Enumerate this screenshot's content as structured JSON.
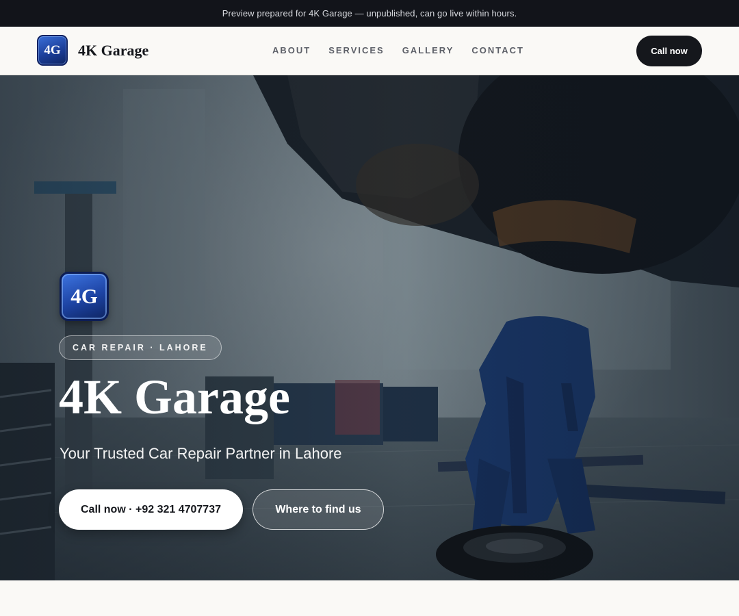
{
  "banner": {
    "text": "Preview prepared for 4K Garage — unpublished, can go live within hours."
  },
  "header": {
    "logo_text": "4G",
    "brand_name": "4K Garage",
    "menu": [
      {
        "label": "ABOUT"
      },
      {
        "label": "SERVICES"
      },
      {
        "label": "GALLERY"
      },
      {
        "label": "CONTACT"
      }
    ],
    "cta_label": "Call now"
  },
  "hero": {
    "logo_text": "4G",
    "eyebrow": "CAR REPAIR · LAHORE",
    "title": "4K Garage",
    "subtitle": "Your Trusted Car Repair Partner in Lahore",
    "primary_button": "Call now · +92 321 4707737",
    "secondary_button": "Where to find us",
    "background_image": "mechanic-under-lifted-car-workshop-photo"
  },
  "colors": {
    "banner_bg": "#12141a",
    "nav_bg": "#faf9f6",
    "cta_bg": "#15171c",
    "logo_blue": "#1c3f9a"
  }
}
